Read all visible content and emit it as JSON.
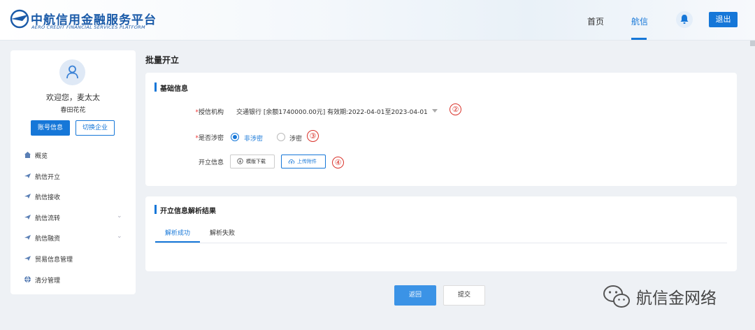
{
  "header": {
    "brand_cn": "中航信用金融服务平台",
    "brand_en": "AERO CREDIT FINANCIAL SERVICES PLATFORM",
    "nav": {
      "home": "首页",
      "hangxin": "航信"
    },
    "logout": "退出"
  },
  "sidebar": {
    "welcome": "欢迎您，麦太太",
    "company": "春田花花",
    "btn_account": "账号信息",
    "btn_switch": "切换企业",
    "items": [
      {
        "label": "概览",
        "icon": "home-icon"
      },
      {
        "label": "航信开立",
        "icon": "plane-icon"
      },
      {
        "label": "航信接收",
        "icon": "plane-icon"
      },
      {
        "label": "航信流转",
        "icon": "plane-icon",
        "expandable": true
      },
      {
        "label": "航信融资",
        "icon": "plane-icon",
        "expandable": true
      },
      {
        "label": "贸易信息管理",
        "icon": "plane-icon"
      },
      {
        "label": "清分管理",
        "icon": "globe-icon"
      }
    ]
  },
  "main": {
    "page_title": "批量开立",
    "basic": {
      "title": "基础信息",
      "institution_label": "授信机构",
      "institution_value": "交通银行 [余额1740000.00元] 有效期:2022-04-01至2023-04-01",
      "secret_label": "是否涉密",
      "radio_non_secret": "非涉密",
      "radio_secret": "涉密",
      "open_info_label": "开立信息",
      "btn_template": "模版下载",
      "btn_upload": "上传附件",
      "required_mark": "*",
      "annotations": [
        "②",
        "③",
        "④"
      ]
    },
    "result": {
      "title": "开立信息解析结果",
      "tab_success": "解析成功",
      "tab_fail": "解析失败"
    },
    "actions": {
      "back": "返回",
      "submit": "提交"
    }
  },
  "watermark": {
    "text": "航信金网络"
  },
  "colors": {
    "primary": "#1677d8",
    "annotation": "#d9332b"
  }
}
